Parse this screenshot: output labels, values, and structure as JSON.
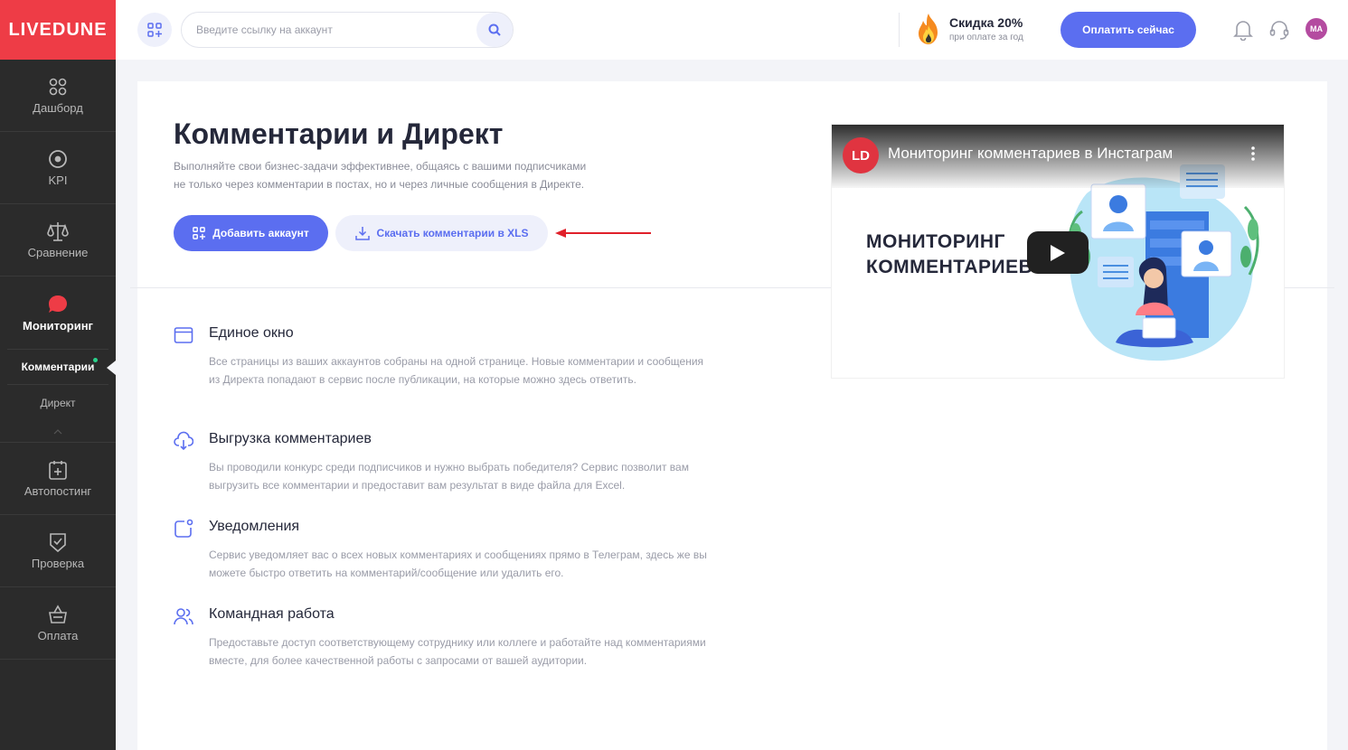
{
  "brand": {
    "logo": "LIVEDUNE",
    "accent": "#ee3c46",
    "primary": "#5b6ef0"
  },
  "sidebar": {
    "items": [
      {
        "label": "Дашборд",
        "icon": "dashboard-icon"
      },
      {
        "label": "KPI",
        "icon": "target-icon"
      },
      {
        "label": "Сравнение",
        "icon": "scales-icon"
      },
      {
        "label": "Мониторинг",
        "icon": "chat-bubble-icon"
      }
    ],
    "submenu": [
      {
        "label": "Комментарии"
      },
      {
        "label": "Директ"
      }
    ],
    "items_bottom": [
      {
        "label": "Автопостинг",
        "icon": "calendar-plus-icon"
      },
      {
        "label": "Проверка",
        "icon": "shield-check-icon"
      },
      {
        "label": "Оплата",
        "icon": "basket-icon"
      }
    ]
  },
  "topbar": {
    "search_placeholder": "Введите ссылку на аккаунт",
    "promo_title": "Скидка 20%",
    "promo_sub": "при оплате за год",
    "pay_button": "Оплатить сейчас",
    "avatar_initials": "MA"
  },
  "main": {
    "title": "Комментарии и Директ",
    "subtitle_line1": "Выполняйте свои бизнес-задачи эффективнее, общаясь с вашими подписчиками",
    "subtitle_line2": "не только через комментарии в постах, но и через личные сообщения в Директе.",
    "add_account": "Добавить аккаунт",
    "download_xls": "Скачать комментарии в XLS",
    "features": [
      {
        "title": "Единое окно",
        "text": "Все страницы из ваших аккаунтов собраны на одной странице. Новые комментарии и сообщения из Директа попадают в сервис после публикации, на которые можно здесь ответить."
      },
      {
        "title": "Выгрузка комментариев",
        "text": "Вы проводили конкурс среди подписчиков и нужно выбрать победителя? Сервис позволит вам выгрузить все комментарии и предоставит вам результат в виде файла для Excel."
      },
      {
        "title": "Уведомления",
        "text": "Сервис уведомляет вас о всех новых комментариях и сообщениях прямо в Телеграм, здесь же вы можете быстро ответить на комментарий/сообщение или удалить его."
      },
      {
        "title": "Командная работа",
        "text": "Предоставьте доступ соответствующему сотруднику или коллеге и работайте над комментариями вместе, для более качественной работы с запросами от вашей аудитории."
      }
    ]
  },
  "video": {
    "channel_logo": "LD",
    "title": "Мониторинг комментариев в Инстаграм",
    "big_line1": "МОНИТОРИНГ",
    "big_line2": "КОММЕНТАРИЕВ"
  }
}
